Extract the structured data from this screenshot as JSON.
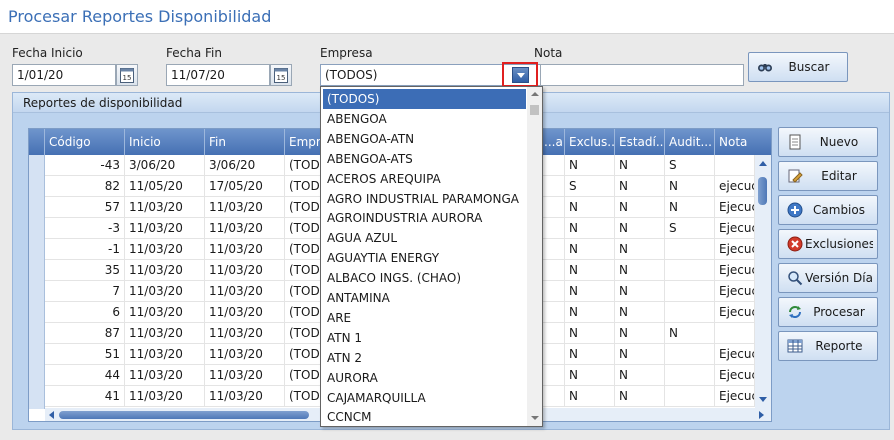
{
  "window": {
    "title": "Procesar Reportes Disponibilidad"
  },
  "filters": {
    "fecha_inicio_label": "Fecha Inicio",
    "fecha_inicio_value": "1/01/20",
    "fecha_fin_label": "Fecha Fin",
    "fecha_fin_value": "11/07/20",
    "empresa_label": "Empresa",
    "empresa_value": "(TODOS)",
    "nota_label": "Nota",
    "nota_value": ""
  },
  "buttons": {
    "buscar": "Buscar",
    "nuevo": "Nuevo",
    "editar": "Editar",
    "cambios": "Cambios",
    "exclusiones": "Exclusiones",
    "version": "Versión Día",
    "procesar": "Procesar",
    "reporte": "Reporte"
  },
  "group": {
    "title": "Reportes de disponibilidad"
  },
  "grid": {
    "columns": [
      "Código",
      "Inicio",
      "Fin",
      "Empre",
      "...a",
      "Exclus...",
      "Estadí...",
      "Audit...",
      "Nota"
    ],
    "rows": [
      [
        "-43",
        "3/06/20",
        "3/06/20",
        "(TODO",
        "",
        "N",
        "N",
        "S",
        ""
      ],
      [
        "82",
        "11/05/20",
        "17/05/20",
        "(TODO",
        "",
        "S",
        "N",
        "N",
        "ejecuci"
      ],
      [
        "57",
        "11/03/20",
        "11/03/20",
        "(TODO",
        "",
        "N",
        "N",
        "N",
        "Ejecuci"
      ],
      [
        "-3",
        "11/03/20",
        "11/03/20",
        "(TODO",
        "",
        "N",
        "N",
        "S",
        "Ejecuci"
      ],
      [
        "-1",
        "11/03/20",
        "11/03/20",
        "(TODO",
        "",
        "N",
        "N",
        "",
        "Ejecuci"
      ],
      [
        "35",
        "11/03/20",
        "11/03/20",
        "(TODO",
        "",
        "N",
        "N",
        "",
        "Ejecuci"
      ],
      [
        "7",
        "11/03/20",
        "11/03/20",
        "(TODO",
        "",
        "N",
        "N",
        "",
        "Ejecuci"
      ],
      [
        "6",
        "11/03/20",
        "11/03/20",
        "(TODO",
        "",
        "N",
        "N",
        "",
        "Ejecuci"
      ],
      [
        "87",
        "11/03/20",
        "11/03/20",
        "(TODO",
        "",
        "N",
        "N",
        "N",
        ""
      ],
      [
        "51",
        "11/03/20",
        "11/03/20",
        "(TODO",
        "",
        "N",
        "N",
        "",
        "Ejecuci"
      ],
      [
        "44",
        "11/03/20",
        "11/03/20",
        "(TODO",
        "",
        "N",
        "N",
        "",
        "Ejecuci"
      ],
      [
        "41",
        "11/03/20",
        "11/03/20",
        "(TODO",
        "",
        "N",
        "N",
        "",
        "Ejecuci"
      ]
    ]
  },
  "dropdown": {
    "selected": "(TODOS)",
    "items": [
      "(TODOS)",
      "ABENGOA",
      "ABENGOA-ATN",
      "ABENGOA-ATS",
      "ACEROS AREQUIPA",
      "AGRO INDUSTRIAL PARAMONGA",
      "AGROINDUSTRIA AURORA",
      "AGUA AZUL",
      "AGUAYTIA ENERGY",
      "ALBACO INGS. (CHAO)",
      "ANTAMINA",
      "ARE",
      "ATN 1",
      "ATN 2",
      "AURORA",
      "CAJAMARQUILLA",
      "CCNCM"
    ]
  },
  "icons": {
    "calendar_icon": "calendar",
    "binoculars_icon": "binoculars",
    "new_icon": "document",
    "edit_icon": "pencil-doc",
    "changes_icon": "plus-circle",
    "exclusions_icon": "x-circle",
    "version_icon": "magnifier",
    "process_icon": "cycle-arrows",
    "report_icon": "table-grid"
  },
  "colors": {
    "title_blue": "#3b6fb6",
    "header_blue": "#4570b3",
    "selection": "#3c6db6",
    "highlight_red": "#e02020"
  }
}
